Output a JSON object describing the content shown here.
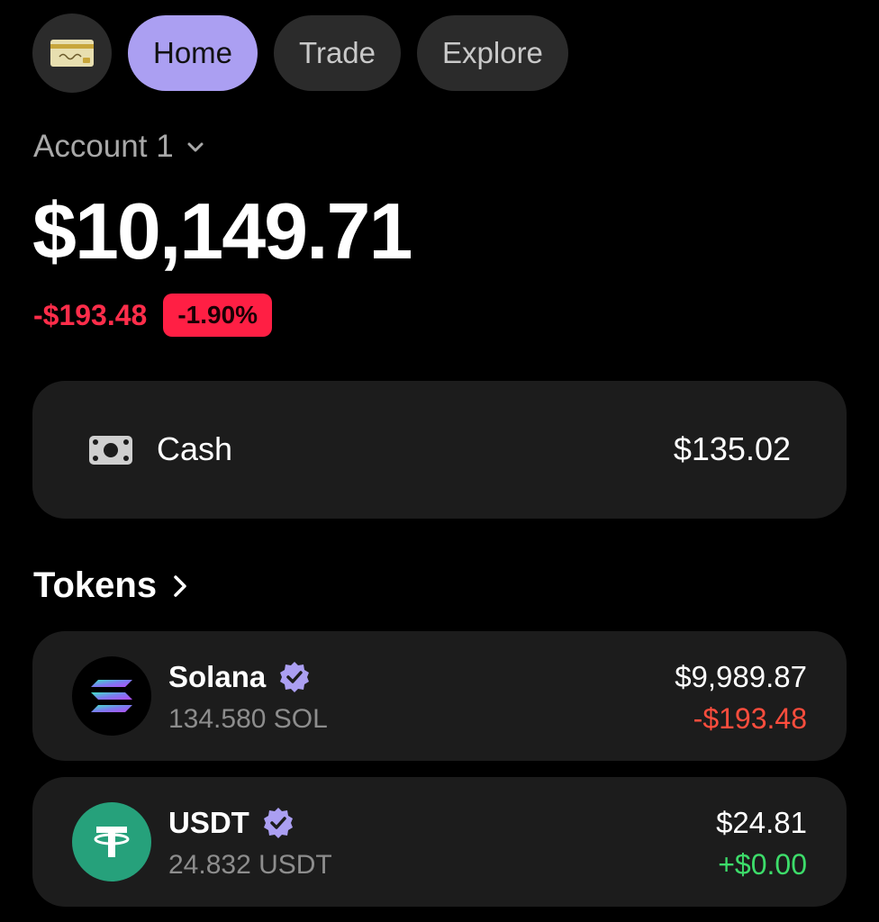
{
  "nav": {
    "wallet_icon": "card-icon",
    "tabs": [
      {
        "label": "Home",
        "active": true
      },
      {
        "label": "Trade",
        "active": false
      },
      {
        "label": "Explore",
        "active": false
      }
    ]
  },
  "account": {
    "name": "Account 1",
    "selector_icon": "chevron-down-icon",
    "balance": "$10,149.71",
    "change_amount": "-$193.48",
    "change_percent": "-1.90%"
  },
  "cash": {
    "icon": "banknote-icon",
    "label": "Cash",
    "value": "$135.02"
  },
  "tokens": {
    "title": "Tokens",
    "chevron_icon": "chevron-right-icon",
    "items": [
      {
        "name": "Solana",
        "verified_icon": "verified-badge-icon",
        "amount": "134.580 SOL",
        "value": "$9,989.87",
        "change": "-$193.48",
        "change_color": "#ff4d3d"
      },
      {
        "name": "USDT",
        "verified_icon": "verified-badge-icon",
        "amount": "24.832 USDT",
        "value": "$24.81",
        "change": "+$0.00",
        "change_color": "#3ddc6a"
      }
    ]
  },
  "colors": {
    "accent": "#ab9ff2",
    "negative": "#ff2d4a",
    "positive": "#3ddc6a",
    "card_bg": "#1c1c1c"
  }
}
